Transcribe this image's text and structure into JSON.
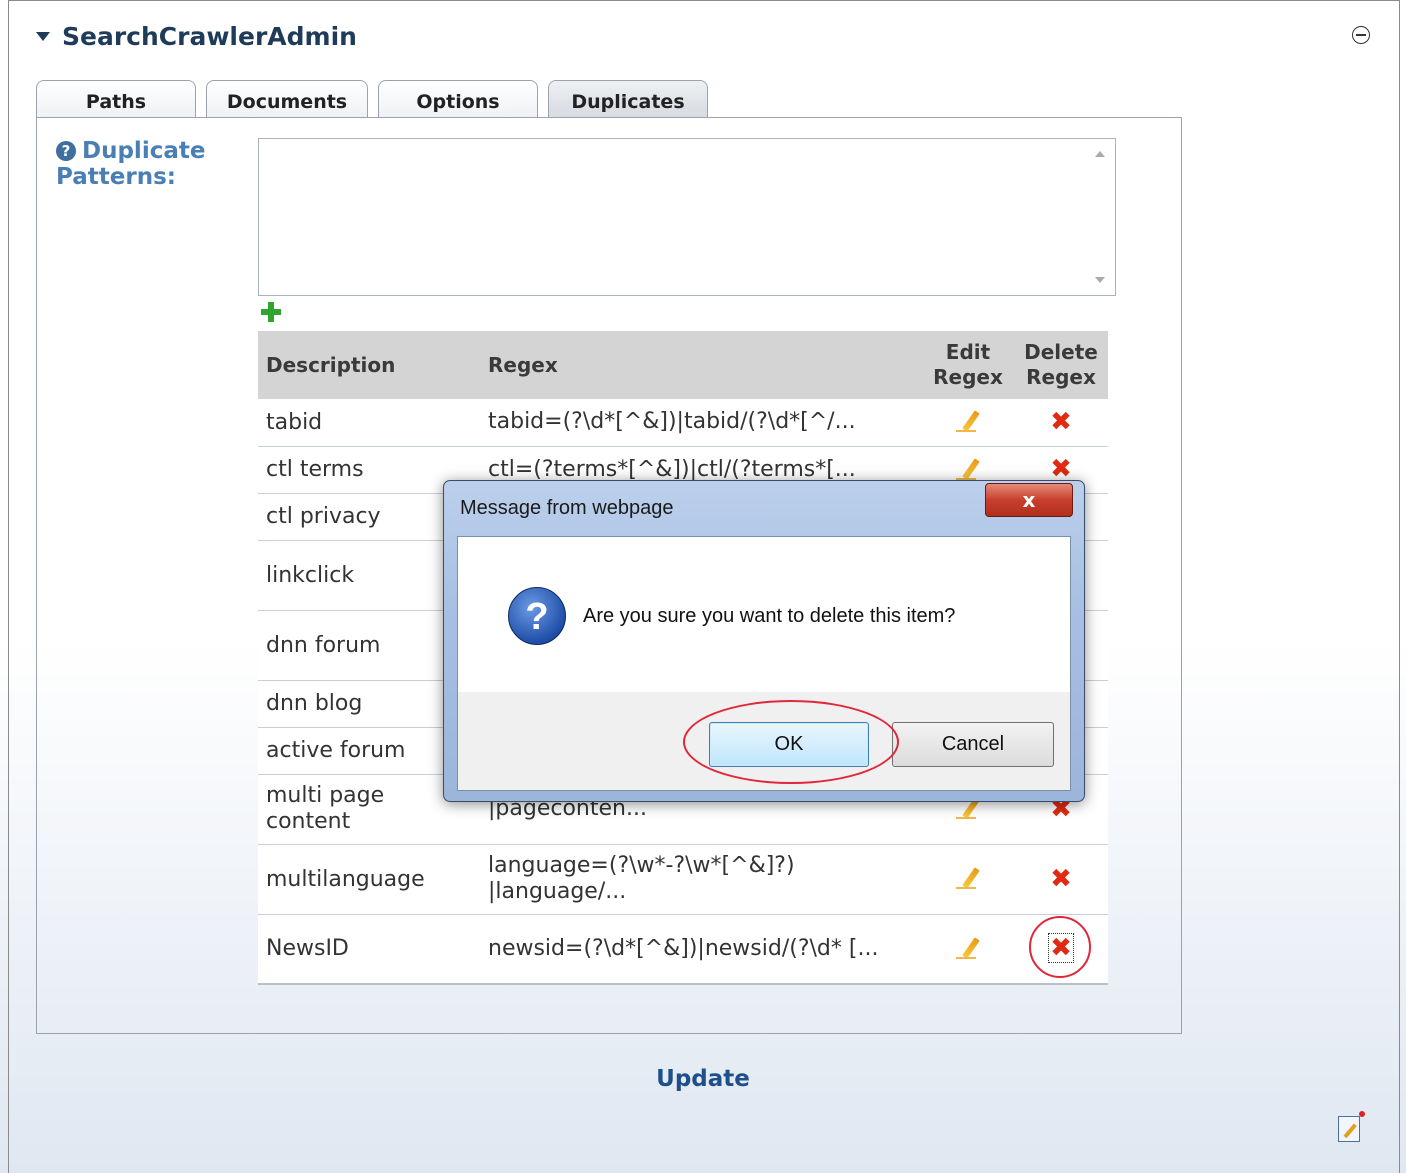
{
  "module": {
    "title": "SearchCrawlerAdmin"
  },
  "tabs": [
    {
      "label": "Paths"
    },
    {
      "label": "Documents"
    },
    {
      "label": "Options"
    },
    {
      "label": "Duplicates"
    }
  ],
  "active_tab": "Duplicates",
  "duplicates": {
    "label": "Duplicate Patterns:",
    "textarea_value": "",
    "columns": {
      "description": "Description",
      "regex": "Regex",
      "edit": "Edit Regex",
      "delete": "Delete Regex"
    },
    "rows": [
      {
        "description": "tabid",
        "regex": "tabid=(?\\d*[^&])|tabid/(?\\d*[^/..."
      },
      {
        "description": "ctl terms",
        "regex": "ctl=(?terms*[^&])|ctl/(?terms*[..."
      },
      {
        "description": "ctl privacy",
        "regex": ""
      },
      {
        "description": "linkclick",
        "regex": ""
      },
      {
        "description": "dnn forum",
        "regex": ""
      },
      {
        "description": "dnn blog",
        "regex": ""
      },
      {
        "description": "active forum",
        "regex": ""
      },
      {
        "description": "multi page content",
        "regex": "|pageconten..."
      },
      {
        "description": "multilanguage",
        "regex": "language=(?\\w*-?\\w*[^&]?) |language/..."
      },
      {
        "description": "NewsID",
        "regex": "newsid=(?\\d*[^&])|newsid/(?\\d* [..."
      }
    ]
  },
  "update_label": "Update",
  "dialog": {
    "title": "Message from webpage",
    "message": "Are you sure you want to delete this item?",
    "ok_label": "OK",
    "cancel_label": "Cancel",
    "close_glyph": "x"
  },
  "colors": {
    "accent": "#1f4f8a",
    "delete": "#e02a12",
    "highlight_circle": "#e0283a"
  }
}
